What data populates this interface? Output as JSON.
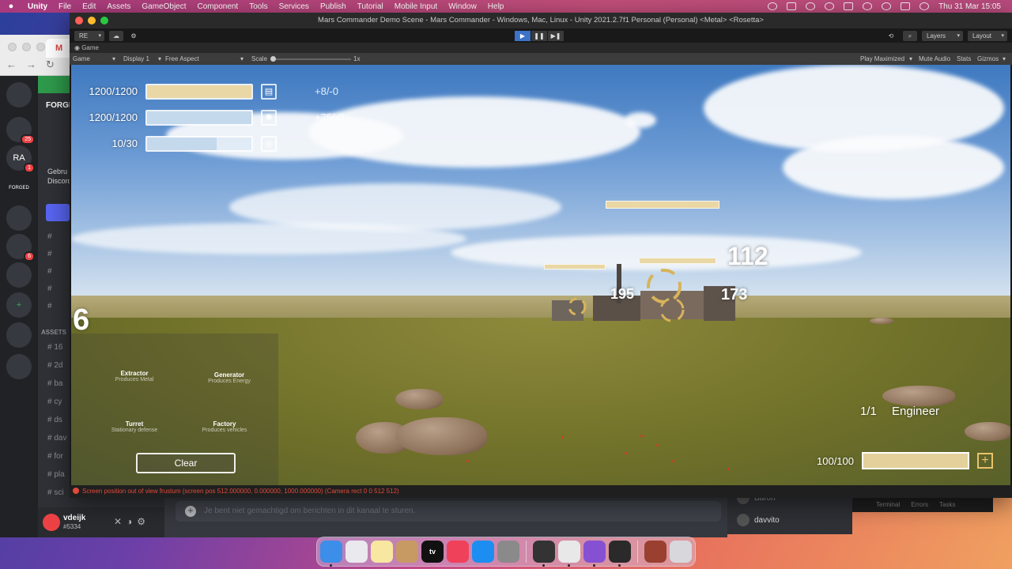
{
  "menubar": {
    "apple": "",
    "items": [
      "Unity",
      "File",
      "Edit",
      "Assets",
      "GameObject",
      "Component",
      "Tools",
      "Services",
      "Publish",
      "Tutorial",
      "Mobile Input",
      "Window",
      "Help"
    ],
    "clock": "Thu 31 Mar  15:05"
  },
  "browser": {
    "tab_letter": "M"
  },
  "discord": {
    "rail": [
      {
        "label": "",
        "icon": "discord-icon"
      },
      {
        "label": "",
        "badge": "25"
      },
      {
        "label": "RA",
        "badge": "1"
      },
      {
        "label": "FORGED"
      },
      {
        "label": ""
      },
      {
        "label": "",
        "badge": "6"
      },
      {
        "label": ""
      },
      {
        "label": "+",
        "icon": "add-server-icon"
      },
      {
        "label": "",
        "icon": "compass-icon"
      },
      {
        "label": "",
        "icon": "download-icon"
      }
    ],
    "server_name": "FORGE",
    "welcome_line1": "Gebru",
    "welcome_line2": "Discord",
    "channels_top": [
      "#",
      "#",
      "#",
      "#",
      "#"
    ],
    "category": "ASSETS",
    "channels": [
      "16",
      "2d",
      "ba",
      "cy",
      "ds",
      "dav",
      "for",
      "pla",
      "sci"
    ],
    "user": {
      "name": "vdeijk",
      "tag": "#5334"
    },
    "message_placeholder": "Je bent niet gemachtigd om berichten in dit kanaal te sturen.",
    "members": [
      "Baron",
      "davvito"
    ]
  },
  "unity": {
    "title": "Mars Commander Demo Scene - Mars Commander - Windows, Mac, Linux - Unity 2021.2.7f1 Personal (Personal) <Metal> <Rosetta>",
    "account": "RE",
    "layers": "Layers",
    "layout": "Layout",
    "tab": "Game",
    "game_bar": {
      "view": "Game",
      "display": "Display 1",
      "aspect": "Free Aspect",
      "scale_label": "Scale",
      "scale_value": "1x",
      "play_maximized": "Play Maximized",
      "mute_audio": "Mute Audio",
      "stats": "Stats",
      "gizmos": "Gizmos"
    },
    "console_error": "Screen position out of view frustum (screen pos 512.000000, 0.000000, 1000.000000) (Camera rect 0 0 512 512)",
    "bottom_tabs": [
      "Terminal",
      "Errors",
      "Tasks"
    ]
  },
  "game": {
    "resources": [
      {
        "label": "1200/1200",
        "fill": 1.0,
        "color": "#e9d7a5",
        "delta": "+8/-0",
        "icon": "metal-icon"
      },
      {
        "label": "1200/1200",
        "fill": 1.0,
        "color": "#c4d9ec",
        "delta": "+75/-0",
        "icon": "energy-icon"
      },
      {
        "label": "10/30",
        "fill": 0.67,
        "color": "#c4d9ec",
        "delta": "",
        "icon": "units-icon"
      }
    ],
    "damage_numbers": [
      "112",
      "195",
      "173"
    ],
    "big_number": "6",
    "build_menu": [
      {
        "name": "Extractor",
        "desc": "Produces Metal"
      },
      {
        "name": "Generator",
        "desc": "Produces Energy"
      },
      {
        "name": "Turret",
        "desc": "Stationary defense"
      },
      {
        "name": "Factory",
        "desc": "Produces vehicles"
      }
    ],
    "clear_label": "Clear",
    "selection_count": "1/1",
    "selection_name": "Engineer",
    "selection_health": "100/100",
    "add_label": "+"
  },
  "dock": [
    {
      "name": "finder-icon",
      "color": "#3d8ee8"
    },
    {
      "name": "launchpad-icon",
      "color": "#e9e9ee"
    },
    {
      "name": "notes-icon",
      "color": "#f7e7a0"
    },
    {
      "name": "contacts-icon",
      "color": "#c79a63"
    },
    {
      "name": "appletv-icon",
      "color": "#111111",
      "label": "tv"
    },
    {
      "name": "music-icon",
      "color": "#f0415a"
    },
    {
      "name": "appstore-icon",
      "color": "#1c8ef1"
    },
    {
      "name": "system-preferences-icon",
      "color": "#8a8a8a"
    },
    {
      "name": "unity-hub-icon",
      "color": "#333333"
    },
    {
      "name": "chrome-icon",
      "color": "#e8e8e8"
    },
    {
      "name": "visual-studio-icon",
      "color": "#8650d3"
    },
    {
      "name": "unity-icon",
      "color": "#2a2a2a"
    },
    {
      "name": "photo-icon",
      "color": "#9a4030"
    },
    {
      "name": "trash-icon",
      "color": "#d8d8dc"
    }
  ]
}
